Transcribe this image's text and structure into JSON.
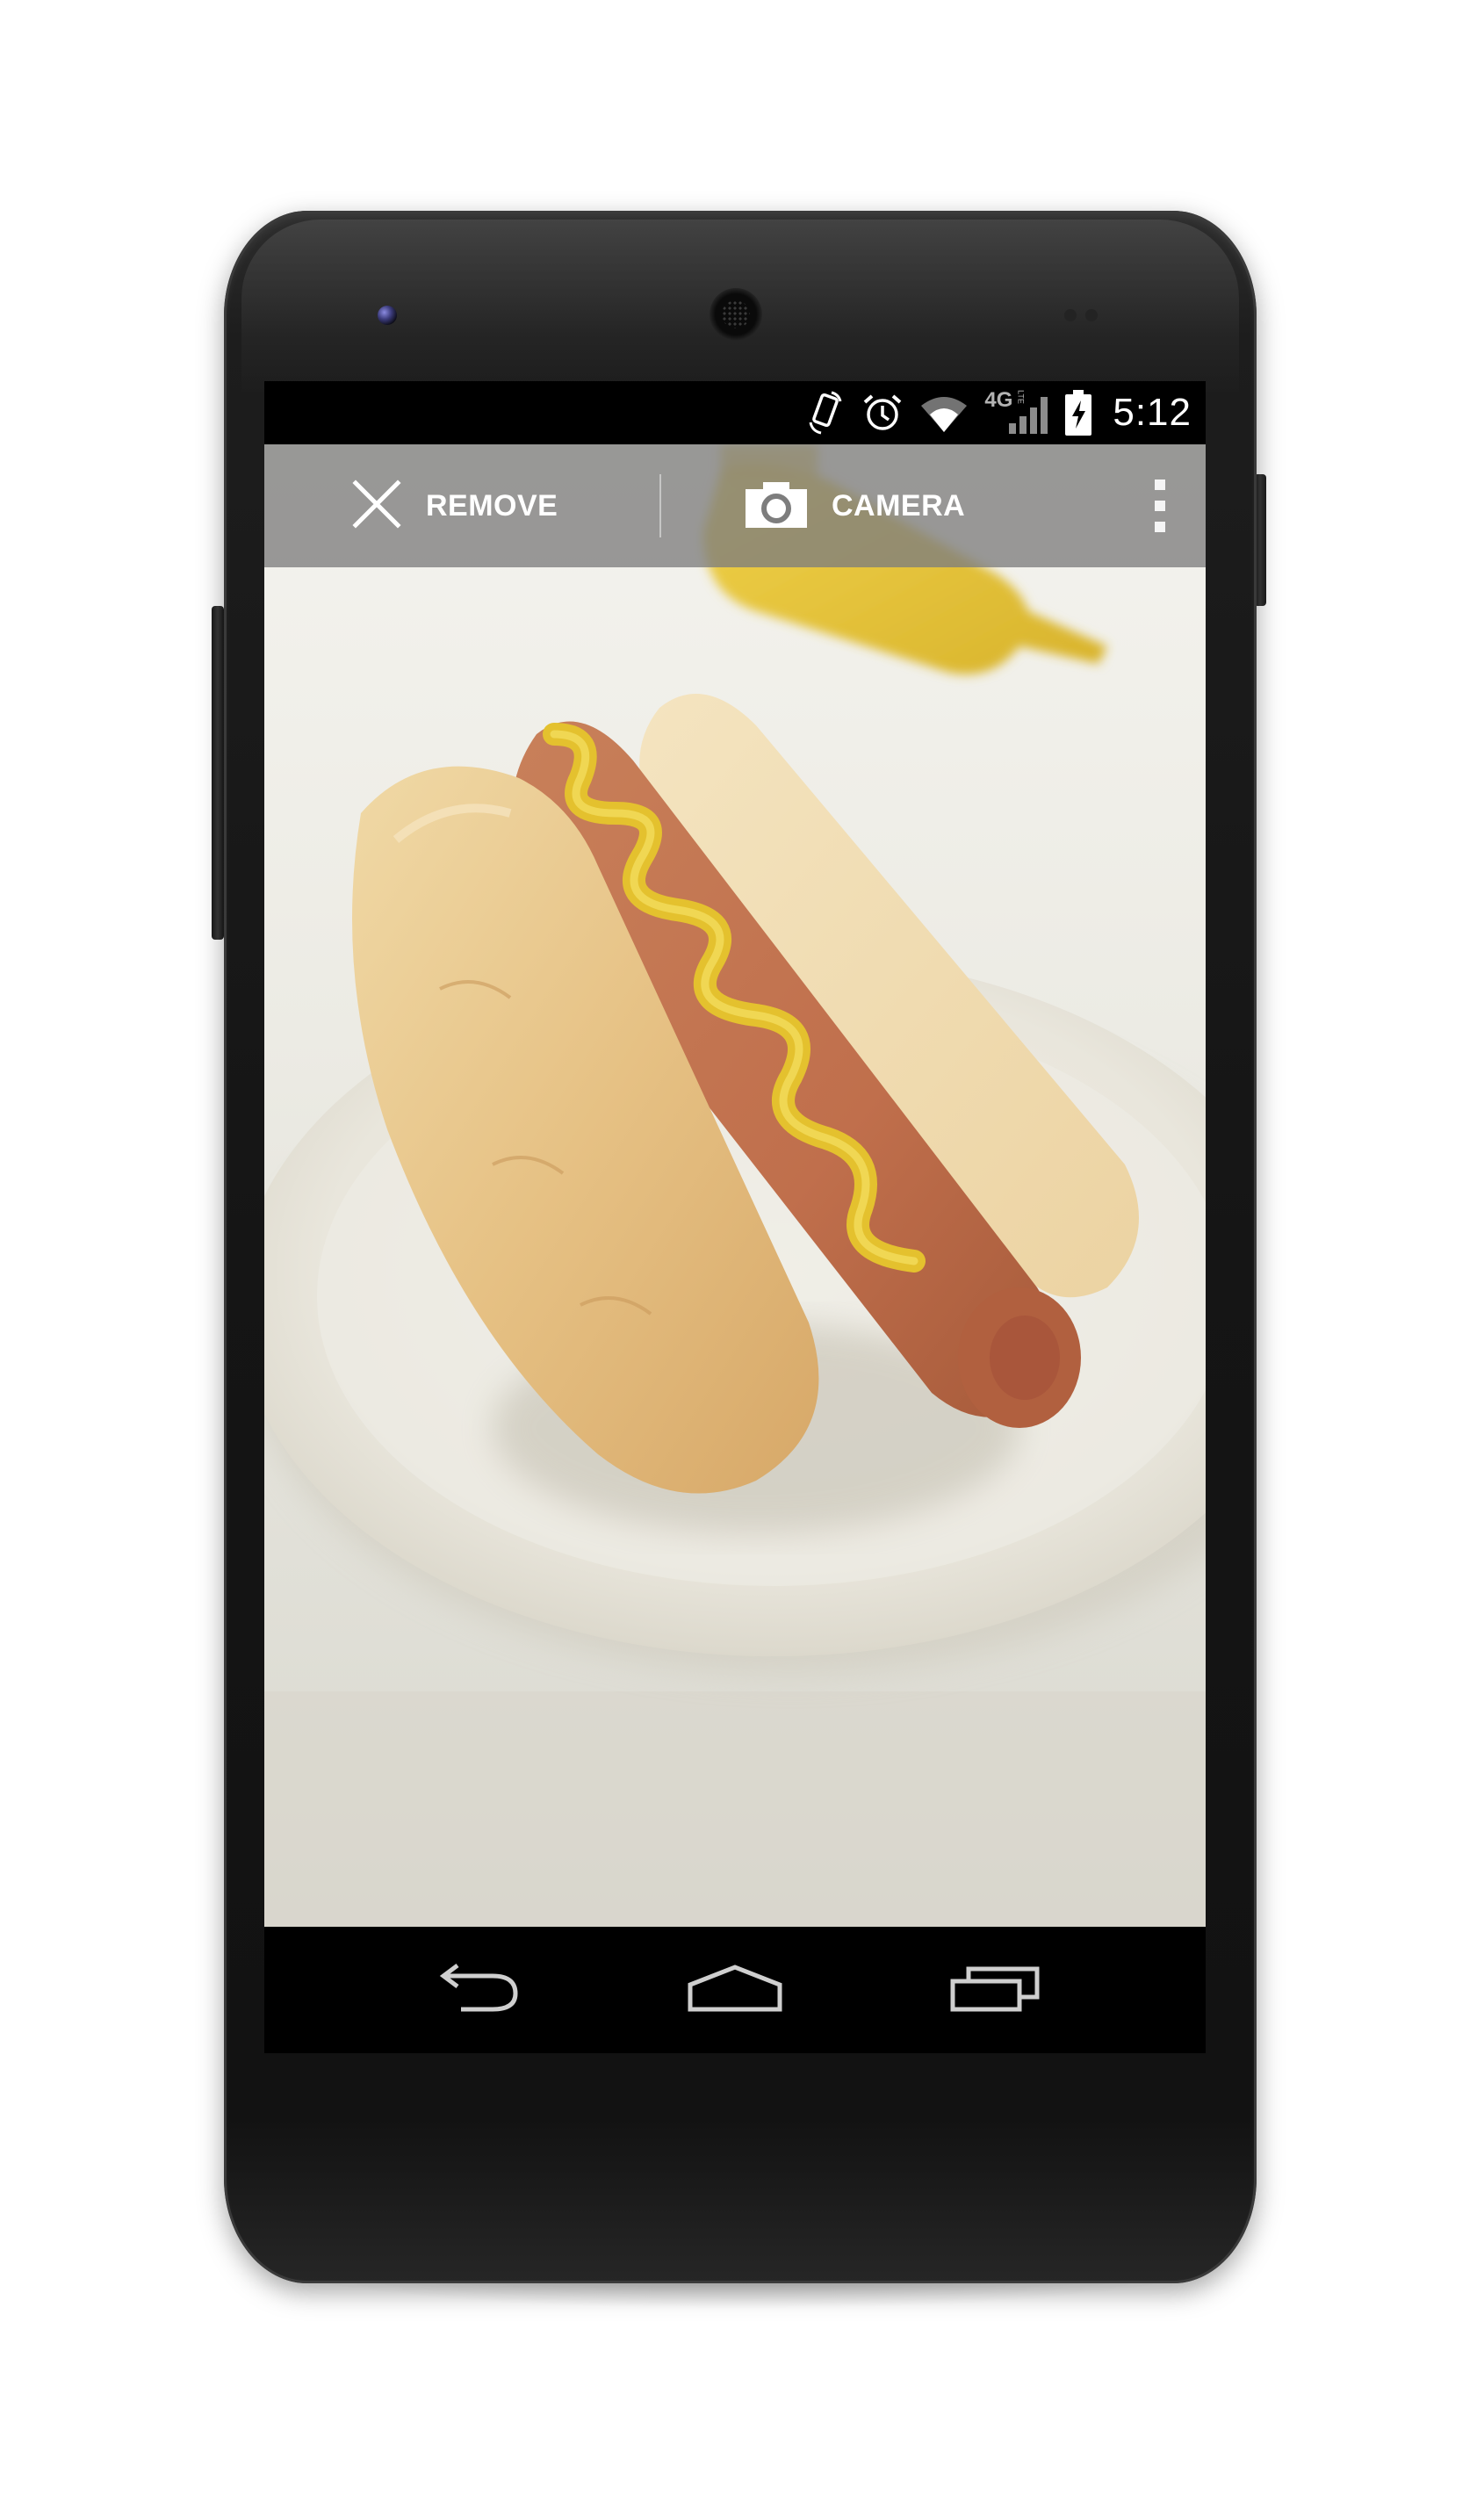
{
  "status_bar": {
    "time": "5:12",
    "network_label": "4G",
    "network_sublabel": "LTE",
    "icons": [
      "screen-rotation-icon",
      "alarm-icon",
      "wifi-icon",
      "signal-icon",
      "battery-charging-icon"
    ]
  },
  "action_bar": {
    "remove_label": "REMOVE",
    "remove_icon": "close-icon",
    "camera_label": "CAMERA",
    "camera_icon": "camera-icon",
    "overflow_icon": "overflow-menu-icon"
  },
  "content": {
    "image_subject": "hot dog with mustard on a plate"
  },
  "nav_bar": {
    "back_icon": "back-icon",
    "home_icon": "home-icon",
    "recents_icon": "recents-icon"
  },
  "colors": {
    "action_bar_bg": "#7d7d7d",
    "status_bar_bg": "#000000",
    "nav_bar_bg": "#000000",
    "phone_body": "#151515"
  }
}
